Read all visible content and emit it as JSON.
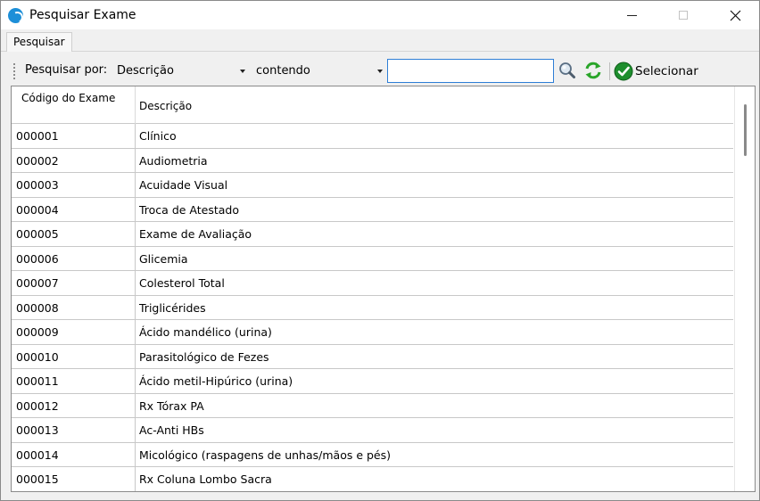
{
  "window": {
    "title": "Pesquisar Exame",
    "icon": "app-logo-icon",
    "accent": "#2e7ed6"
  },
  "tabs": [
    {
      "label": "Pesquisar",
      "active": true
    }
  ],
  "toolbar": {
    "search_by_label": "Pesquisar por:",
    "field_combo_value": "Descrição",
    "operator_combo_value": "contendo",
    "search_value": "",
    "select_label": "Selecionar"
  },
  "grid": {
    "headers": {
      "code": "Código do Exame",
      "description": "Descrição"
    },
    "rows": [
      {
        "code": "000001",
        "description": "Clínico"
      },
      {
        "code": "000002",
        "description": "Audiometria"
      },
      {
        "code": "000003",
        "description": "Acuidade Visual"
      },
      {
        "code": "000004",
        "description": "Troca de Atestado"
      },
      {
        "code": "000005",
        "description": "Exame de Avaliação"
      },
      {
        "code": "000006",
        "description": "Glicemia"
      },
      {
        "code": "000007",
        "description": "Colesterol Total"
      },
      {
        "code": "000008",
        "description": "Triglicérides"
      },
      {
        "code": "000009",
        "description": "Ácido mandélico (urina)"
      },
      {
        "code": "000010",
        "description": "Parasitológico de Fezes"
      },
      {
        "code": "000011",
        "description": "Ácido metil-Hipúrico (urina)"
      },
      {
        "code": "000012",
        "description": "Rx Tórax PA"
      },
      {
        "code": "000013",
        "description": "Ac-Anti HBs"
      },
      {
        "code": "000014",
        "description": "Micológico (raspagens de unhas/mãos e pés)"
      },
      {
        "code": "000015",
        "description": "Rx Coluna Lombo Sacra"
      }
    ]
  }
}
